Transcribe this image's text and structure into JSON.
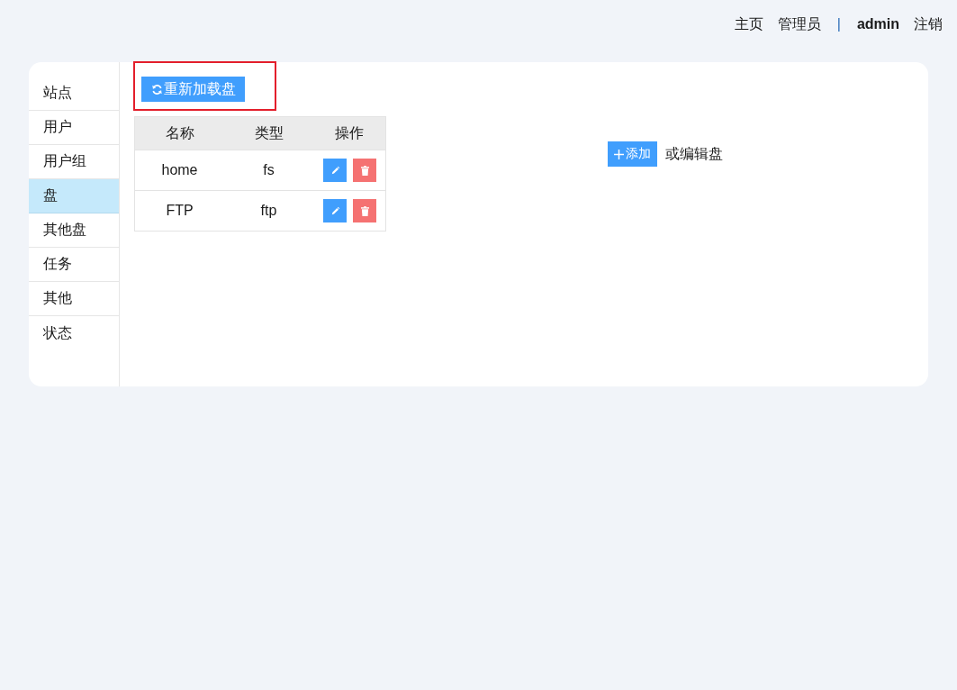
{
  "top_nav": {
    "links": [
      {
        "label": "主页"
      },
      {
        "label": "管理员"
      }
    ],
    "separator": "|",
    "user": "admin",
    "logout": "注销"
  },
  "sidebar": {
    "items": [
      {
        "label": "站点",
        "selected": false
      },
      {
        "label": "用户",
        "selected": false
      },
      {
        "label": "用户组",
        "selected": false
      },
      {
        "label": "盘",
        "selected": true
      },
      {
        "label": "其他盘",
        "selected": false
      },
      {
        "label": "任务",
        "selected": false
      },
      {
        "label": "其他",
        "selected": false
      },
      {
        "label": "状态",
        "selected": false
      }
    ]
  },
  "toolbar": {
    "reload_button": {
      "label": "重新加载盘",
      "highlighted": true
    }
  },
  "table": {
    "columns": [
      "名称",
      "类型",
      "操作"
    ],
    "rows": [
      {
        "name": "home",
        "type": "fs"
      },
      {
        "name": "FTP",
        "type": "ftp"
      }
    ]
  },
  "editor": {
    "add_button": "添加",
    "hint": "或编辑盘"
  }
}
